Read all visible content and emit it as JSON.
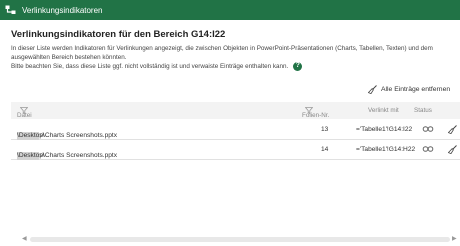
{
  "window": {
    "title": "Verlinkungsindikatoren"
  },
  "heading": "Verlinkungsindikatoren für den Bereich G14:I22",
  "description": {
    "line1": "In dieser Liste werden Indikatoren für Verlinkungen angezeigt, die zwischen Objekten in PowerPoint-Präsentationen (Charts, Tabellen, Texten) und dem",
    "line2": "ausgewählten Bereich bestehen könnten.",
    "line3": "Bitte beachten Sie, dass diese Liste ggf. nicht vollständig ist und verwaiste Einträge enthalten kann.",
    "help_label": "?"
  },
  "actions": {
    "remove_all_label": "Alle Einträge entfernen"
  },
  "table": {
    "columns": {
      "file": "Datei",
      "slide": "Folien-Nr.",
      "linked": "Verlinkt mit",
      "status": "Status"
    },
    "rows": [
      {
        "path_prefix": "C:\\Users\\",
        "path_suffix": "\\Desktop\\Charts Screenshots.pptx",
        "slide": "13",
        "linked": "='Tabelle1'!G14:I22"
      },
      {
        "path_prefix": "C:\\Users\\",
        "path_suffix": "\\Desktop\\Charts Screenshots.pptx",
        "slide": "14",
        "linked": "='Tabelle1'!G14:H22"
      }
    ]
  },
  "colors": {
    "accent": "#217346",
    "header_bg": "#f3f3f3"
  }
}
